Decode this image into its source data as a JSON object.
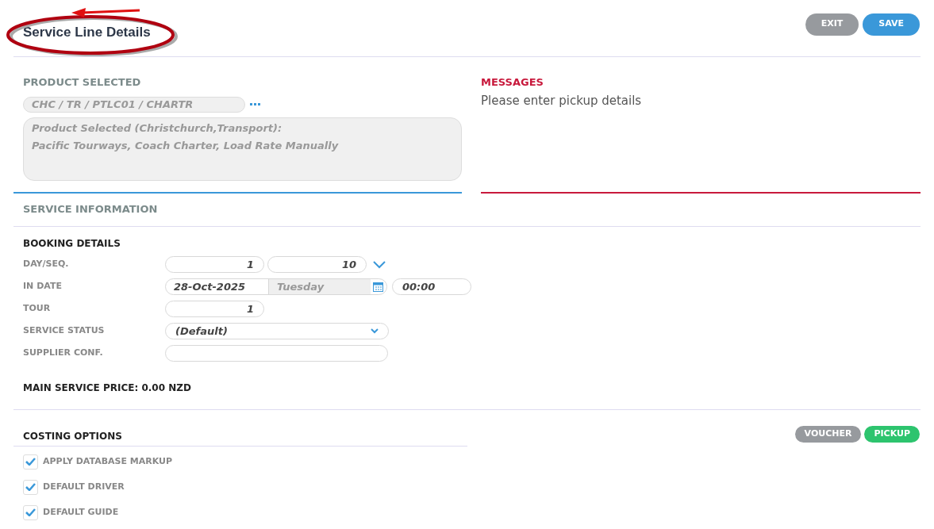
{
  "header": {
    "title": "Service Line Details",
    "buttons": [
      {
        "label": "EXIT",
        "kind": "secondary"
      },
      {
        "label": "SAVE",
        "kind": "primary"
      }
    ]
  },
  "product": {
    "heading": "PRODUCT SELECTED",
    "code": "CHC / TR / PTLC01 / CHARTR",
    "description": [
      "Product Selected (Christchurch,Transport):",
      "Pacific Tourways, Coach Charter, Load Rate Manually"
    ]
  },
  "messages": {
    "heading": "MESSAGES",
    "text": "Please enter pickup details"
  },
  "service_information": {
    "heading": "SERVICE INFORMATION"
  },
  "booking": {
    "heading": "BOOKING DETAILS",
    "rows": [
      {
        "label": "DAY/SEQ.",
        "kind": "pair",
        "values": [
          "1",
          "10"
        ]
      },
      {
        "label": "IN DATE",
        "kind": "date",
        "date": "28-Oct-2025",
        "weekday": "Tuesday",
        "time": "00:00"
      },
      {
        "label": "TOUR",
        "kind": "number",
        "value": "1"
      },
      {
        "label": "SERVICE STATUS",
        "kind": "select",
        "value": "(Default)"
      },
      {
        "label": "SUPPLIER CONF.",
        "kind": "text"
      }
    ],
    "price": "MAIN SERVICE PRICE: 0.00 NZD"
  },
  "costing": {
    "heading": "COSTING OPTIONS",
    "buttons": [
      {
        "label": "VOUCHER",
        "kind": "secondary"
      },
      {
        "label": "PICKUP",
        "kind": "success"
      }
    ],
    "options": [
      {
        "label": "APPLY DATABASE MARKUP",
        "checked": true
      },
      {
        "label": "DEFAULT DRIVER",
        "checked": true
      },
      {
        "label": "DEFAULT GUIDE",
        "checked": true
      }
    ]
  }
}
